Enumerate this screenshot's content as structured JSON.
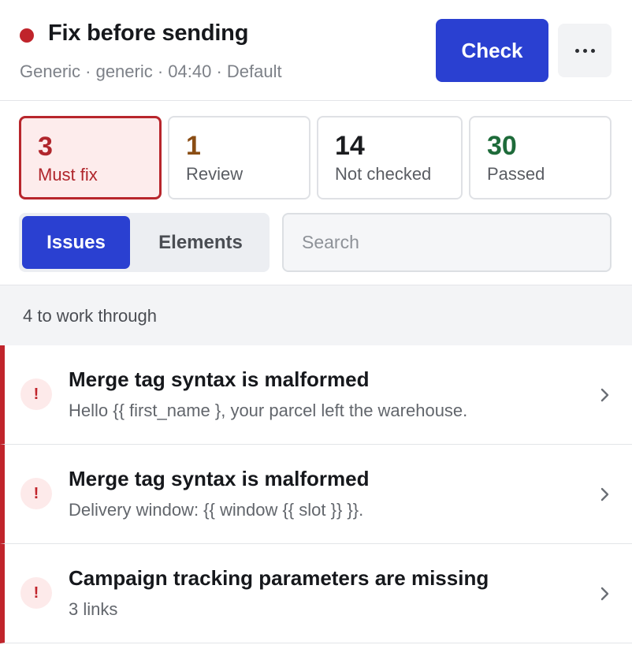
{
  "header": {
    "title": "Fix before sending",
    "subtitle": "Generic · generic · 04:40 · Default",
    "check_label": "Check",
    "more_icon": "ellipsis-icon"
  },
  "stats": [
    {
      "count": "3",
      "label": "Must fix",
      "selected": true
    },
    {
      "count": "1",
      "label": "Review"
    },
    {
      "count": "14",
      "label": "Not checked"
    },
    {
      "count": "30",
      "label": "Passed"
    }
  ],
  "tabs": {
    "issues": "Issues",
    "elements": "Elements",
    "active": "Issues"
  },
  "search": {
    "placeholder": "Search",
    "value": ""
  },
  "list": {
    "summary": "4 to work through",
    "items": [
      {
        "title": "Merge tag syntax is malformed",
        "desc": "Hello {{ first_name }, your parcel left the warehouse.",
        "severity": "must-fix"
      },
      {
        "title": "Merge tag syntax is malformed",
        "desc": "Delivery window: {{ window {{ slot }} }}.",
        "severity": "must-fix"
      },
      {
        "title": "Campaign tracking parameters are missing",
        "desc": "3 links",
        "severity": "must-fix"
      }
    ],
    "badge_symbol": "!"
  },
  "colors": {
    "accent": "#2a40d1",
    "error": "#c0242b",
    "review": "#8a4d14",
    "passed": "#1e6b3a"
  }
}
